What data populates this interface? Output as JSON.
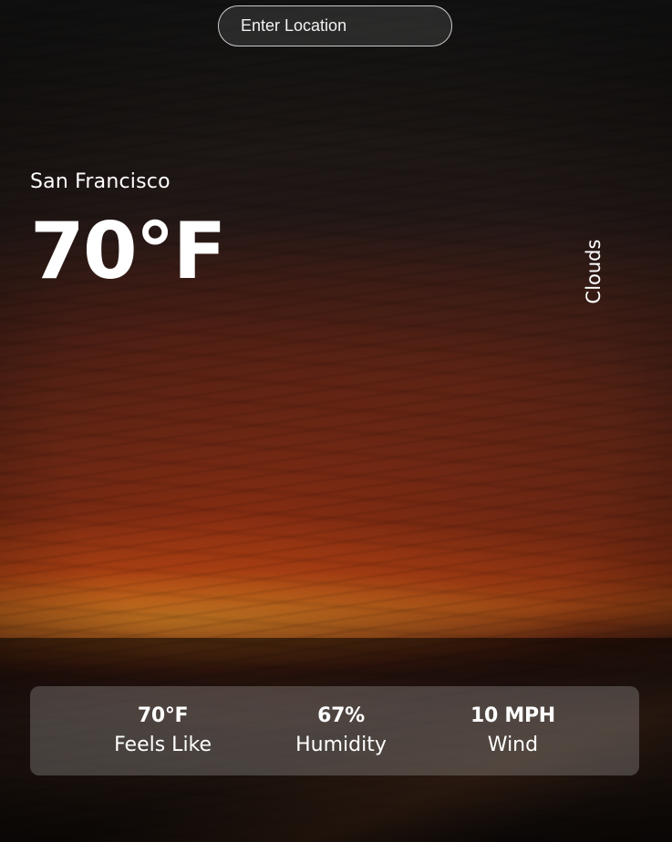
{
  "search": {
    "placeholder": "Enter Location"
  },
  "current": {
    "location": "San Francisco",
    "temperature": "70°F",
    "description": "Clouds"
  },
  "stats": [
    {
      "value": "70°F",
      "label": "Feels Like"
    },
    {
      "value": "67%",
      "label": "Humidity"
    },
    {
      "value": "10 MPH",
      "label": "Wind"
    }
  ],
  "colors": {
    "text": "#ffffff",
    "panel": "rgba(190,190,190,0.28)"
  }
}
